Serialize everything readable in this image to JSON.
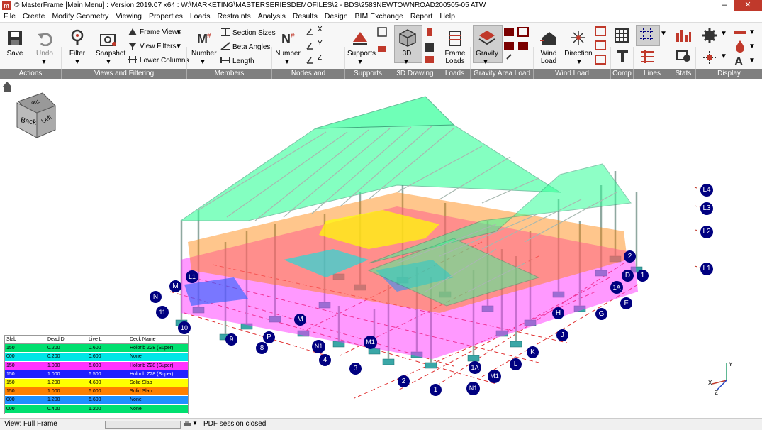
{
  "window": {
    "title": "© MasterFrame [Main Menu] : Version 2019.07 x64 : W:\\MARKETING\\MASTERSERIESDEMOFILES\\2 - BDS\\2583NEWTOWNROAD200505-05 ATW",
    "app_icon": "m",
    "minimize": "–",
    "maximize": "□",
    "close": "✕"
  },
  "menu": [
    "File",
    "Create",
    "Modify Geometry",
    "Viewing",
    "Properties",
    "Loads",
    "Restraints",
    "Analysis",
    "Results",
    "Design",
    "BIM Exchange",
    "Report",
    "Help"
  ],
  "ribbon": {
    "save": "Save",
    "undo": "Undo",
    "filter": "Filter",
    "snapshot": "Snapshot",
    "frame_views": "Frame Views",
    "view_filters": "View Filters",
    "lower_columns": "Lower Columns",
    "member_number": "Number",
    "section_sizes": "Section Sizes",
    "beta_angles": "Beta Angles",
    "length": "Length",
    "node_number": "Number",
    "supports": "Supports",
    "threed": "3D",
    "frame_loads": "Frame\nLoads",
    "gravity": "Gravity",
    "wind_load": "Wind\nLoad",
    "direction": "Direction",
    "axis_x": "X",
    "axis_y": "Y",
    "axis_z": "Z"
  },
  "groups": [
    "Actions",
    "Views and Filtering",
    "Members",
    "Nodes and Coordinates",
    "Supports",
    "3D Drawing",
    "Loads",
    "Gravity Area Load",
    "Wind Load",
    "Comp",
    "Lines",
    "Stats",
    "Display"
  ],
  "viewcube": {
    "front": "Back",
    "side": "Left",
    "top": "Top"
  },
  "levels": [
    "L4",
    "L3",
    "L2",
    "L1"
  ],
  "gridlabels": {
    "g2a": "2",
    "gD": "D",
    "g1": "1",
    "g1A": "1A",
    "gF": "F",
    "gG": "G",
    "gH": "H",
    "gJ": "J",
    "gK": "K",
    "gL": "L",
    "gM1a": "M1",
    "gN1a": "N1",
    "g1b": "1",
    "g2b": "2",
    "g3": "3",
    "g4": "4",
    "gN1b": "N1",
    "gM1b": "M1",
    "g8": "8",
    "g9": "9",
    "g10": "10",
    "g11": "11",
    "gN": "N",
    "gL1": "L1",
    "gM": "M",
    "gP": "P",
    "gM2": "M",
    "g1Ab": "1A"
  },
  "legend": {
    "headers": [
      "Slab",
      "Dead D",
      "Live L",
      "Deck Name"
    ],
    "rows": [
      {
        "slab": "150",
        "dead": "0.200",
        "live": "0.600",
        "deck": "Holorib Z28 (Super)",
        "color": "#00e070"
      },
      {
        "slab": "000",
        "dead": "0.200",
        "live": "0.600",
        "deck": "None",
        "color": "#00e6e6"
      },
      {
        "slab": "150",
        "dead": "1.000",
        "live": "6.000",
        "deck": "Holorib Z28 (Super)",
        "color": "#ff33ff"
      },
      {
        "slab": "150",
        "dead": "1.000",
        "live": "6.500",
        "deck": "Holorib Z28 (Super)",
        "color": "#2020ff"
      },
      {
        "slab": "150",
        "dead": "1.200",
        "live": "4.600",
        "deck": "Solid Slab",
        "color": "#ffff00"
      },
      {
        "slab": "150",
        "dead": "1.000",
        "live": "6.000",
        "deck": "Solid Slab",
        "color": "#ff8000"
      },
      {
        "slab": "000",
        "dead": "1.200",
        "live": "6.600",
        "deck": "None",
        "color": "#1e90ff"
      },
      {
        "slab": "000",
        "dead": "0.400",
        "live": "1.200",
        "deck": "None",
        "color": "#00e070"
      }
    ]
  },
  "status": {
    "view": "View: Full Frame",
    "pdf": "PDF session closed"
  },
  "colors": {
    "ribbon_group_bar": "#7f7f7f",
    "grid_marker": "#000080",
    "roof": "#33ff99",
    "close_button": "#c0392b"
  }
}
